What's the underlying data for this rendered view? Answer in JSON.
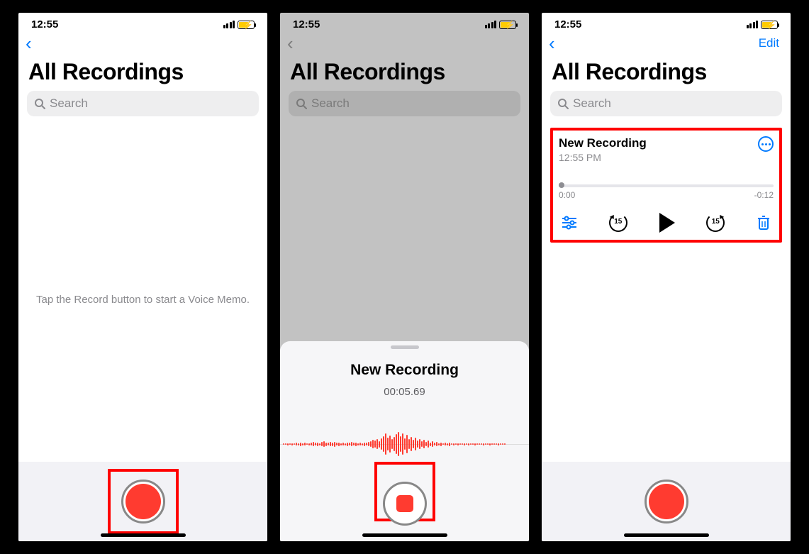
{
  "status": {
    "time": "12:55"
  },
  "screen1": {
    "title": "All Recordings",
    "search_placeholder": "Search",
    "hint": "Tap the Record button to start a Voice Memo."
  },
  "screen2": {
    "title": "All Recordings",
    "search_placeholder": "Search",
    "sheet_title": "New Recording",
    "sheet_timer": "00:05.69"
  },
  "screen3": {
    "title": "All Recordings",
    "search_placeholder": "Search",
    "edit_label": "Edit",
    "recording": {
      "name": "New Recording",
      "timestamp": "12:55 PM",
      "elapsed": "0:00",
      "remaining": "-0:12",
      "skip_seconds": "15"
    }
  }
}
